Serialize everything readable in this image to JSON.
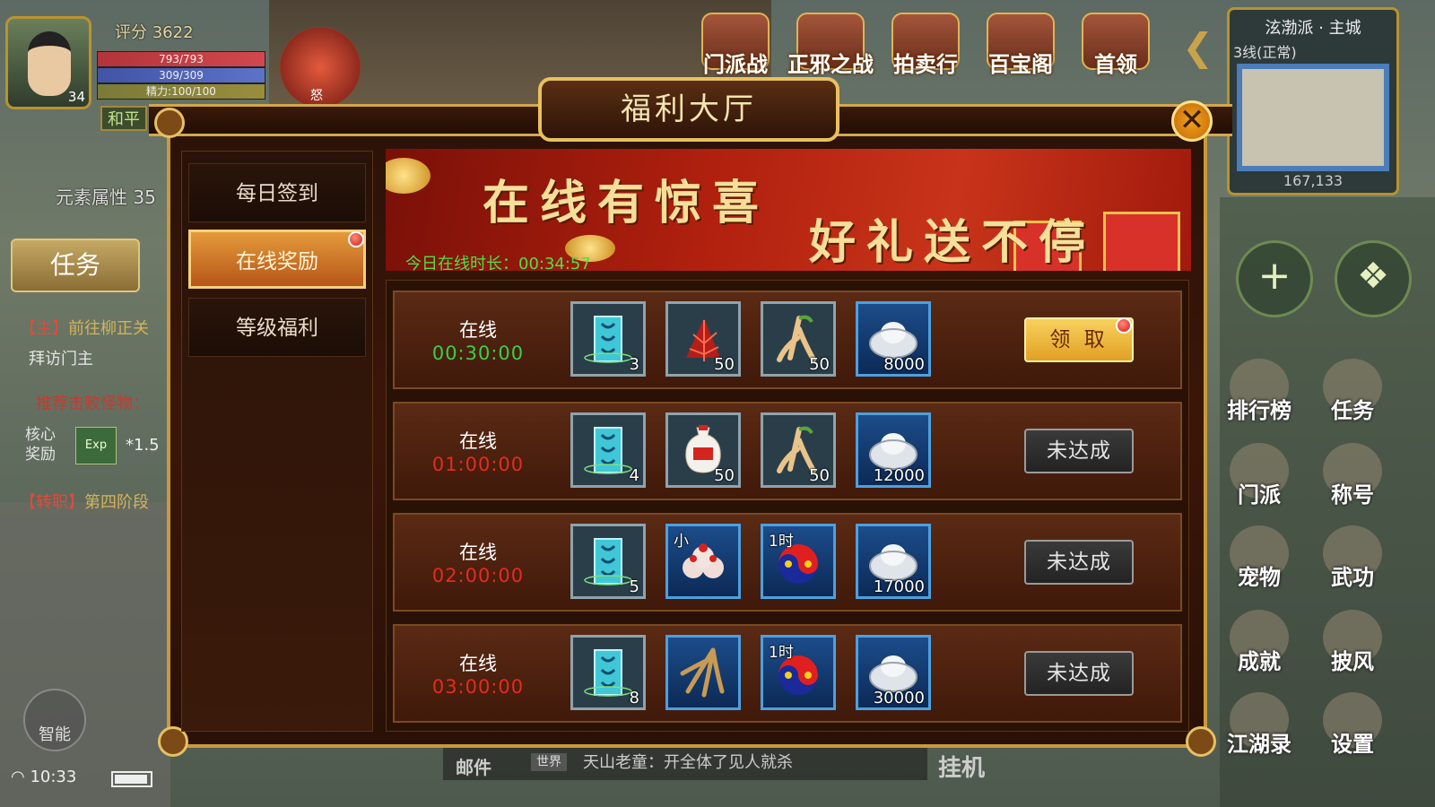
{
  "hud": {
    "score": "评分 3622",
    "level": "34",
    "hp": "793/793",
    "mp": "309/309",
    "stamina": "精力:100/100",
    "pk_mode": "和平",
    "rage_label": "怒",
    "element": "元素属性 35",
    "task_button": "任务",
    "quest_main_tag": "【主】",
    "quest_main_text": "前往柳正关",
    "quest_main_sub": "拜访门主",
    "quest_hint": "推荐击败怪物：",
    "core_reward": "核心\n奖励",
    "core_exp": "Exp",
    "core_mult": "*1.5",
    "quest_job_tag": "【转职】",
    "quest_job_text": "第四阶段",
    "smart": "智能",
    "time": "10:33"
  },
  "top_menu": [
    {
      "label": "门派战",
      "icon": "sect-war-icon"
    },
    {
      "label": "正邪之战",
      "icon": "war-drum-icon"
    },
    {
      "label": "拍卖行",
      "icon": "abacus-icon"
    },
    {
      "label": "百宝阁",
      "icon": "treasure-pavilion-icon"
    },
    {
      "label": "首领",
      "icon": "boss-icon"
    }
  ],
  "minimap": {
    "title": "泫渤派 · 主城",
    "line": "3线(正常)",
    "coords": "167,133"
  },
  "right_menu": [
    {
      "label": "排行榜"
    },
    {
      "label": "任务"
    },
    {
      "label": "门派"
    },
    {
      "label": "称号"
    },
    {
      "label": "宠物"
    },
    {
      "label": "武功"
    },
    {
      "label": "成就"
    },
    {
      "label": "披风"
    },
    {
      "label": "江湖录"
    },
    {
      "label": "设置"
    }
  ],
  "chat": {
    "mail": "邮件",
    "channel": "世界",
    "message": "天山老童：开全体了见人就杀",
    "idle": "挂机"
  },
  "dialog": {
    "title": "福利大厅",
    "close": "✕",
    "tabs": [
      "每日签到",
      "在线奖励",
      "等级福利"
    ],
    "active_tab": 1,
    "banner_line1": "在线有惊喜",
    "banner_line2": "好礼送不停",
    "online_today": "今日在线时长：00:34:57",
    "rows": [
      {
        "label": "在线",
        "time": "00:30:00",
        "time_color": "#39d04a",
        "items": [
          {
            "kind": "scroll",
            "qty": "3",
            "blue": false
          },
          {
            "kind": "herb-red",
            "qty": "50",
            "blue": false
          },
          {
            "kind": "ginseng",
            "qty": "50",
            "blue": false
          },
          {
            "kind": "silver",
            "qty": "8000",
            "blue": true
          }
        ],
        "button": "领 取",
        "state": "claim"
      },
      {
        "label": "在线",
        "time": "01:00:00",
        "time_color": "#e82a1e",
        "items": [
          {
            "kind": "scroll",
            "qty": "4",
            "blue": false
          },
          {
            "kind": "wine-big",
            "qty": "50",
            "blue": false,
            "tag": ""
          },
          {
            "kind": "ginseng",
            "qty": "50",
            "blue": false
          },
          {
            "kind": "silver",
            "qty": "12000",
            "blue": true
          }
        ],
        "button": "未达成",
        "state": "na"
      },
      {
        "label": "在线",
        "time": "02:00:00",
        "time_color": "#e82a1e",
        "items": [
          {
            "kind": "scroll",
            "qty": "5",
            "blue": false
          },
          {
            "kind": "wine-small",
            "qty": "",
            "blue": true,
            "tag": "小"
          },
          {
            "kind": "yinyang",
            "qty": "",
            "blue": true,
            "tag": "1时"
          },
          {
            "kind": "silver",
            "qty": "17000",
            "blue": true
          }
        ],
        "button": "未达成",
        "state": "na"
      },
      {
        "label": "在线",
        "time": "03:00:00",
        "time_color": "#e82a1e",
        "items": [
          {
            "kind": "scroll",
            "qty": "8",
            "blue": false
          },
          {
            "kind": "root",
            "qty": "",
            "blue": true
          },
          {
            "kind": "yinyang",
            "qty": "",
            "blue": true,
            "tag": "1时"
          },
          {
            "kind": "silver",
            "qty": "30000",
            "blue": true
          }
        ],
        "button": "未达成",
        "state": "na"
      }
    ]
  }
}
